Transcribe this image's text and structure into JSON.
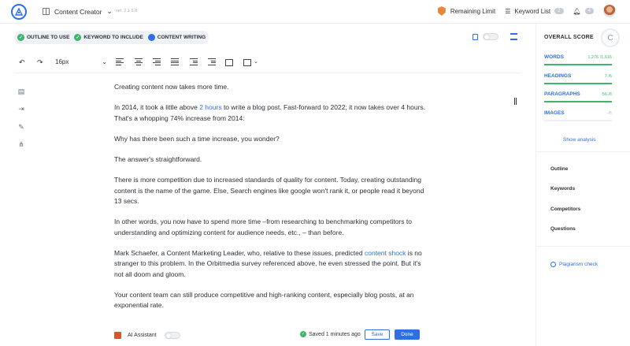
{
  "header": {
    "app_name": "Content Creator",
    "version": "ver. 2.1.5.8",
    "remaining_limit": "Remaining Limit",
    "keyword_list": "Keyword List",
    "keyword_count": "2",
    "notification_count": "4"
  },
  "steps": [
    {
      "label": "OUTLINE TO USE",
      "state": "done"
    },
    {
      "label": "KEYWORD TO INCLUDE",
      "state": "done"
    },
    {
      "label": "CONTENT WRITING",
      "state": "active"
    }
  ],
  "toolbar": {
    "font_size": "16px"
  },
  "editor": {
    "paragraphs": [
      "Creating content now takes more time.",
      {
        "before": "In 2014, it took a little above ",
        "link": "2 hours",
        "after": " to write a blog post. Fast-forward to 2022; it now takes over 4 hours. That's a whopping 74% increase from 2014:"
      },
      "Why has there been such a time increase, you wonder?",
      "The answer's straightforward.",
      "There is more competition due to increased standards of quality for content. Today, creating outstanding content is the name of the game. Else, Search engines like google won't rank it, or people read it beyond 13 secs.",
      "In other words, you now have to spend more time –from researching to benchmarking competitors to understanding and optimizing content for audience needs, etc., – than before.",
      {
        "before": "Mark Schaefer, a Content Marketing Leader, who, relative to these issues, predicted ",
        "link": "content shock",
        "after": " is no stranger to this problem. In the Orbitmedia survey referenced above, he even stressed the point. But it's not all doom and gloom."
      },
      "Your content team can still produce competitive and high-ranking content, especially blog posts, at an exponential rate."
    ]
  },
  "footer": {
    "ai_assistant": "AI Assistant",
    "saved_status": "Saved 1 minutes ago",
    "save_label": "Save",
    "done_label": "Done"
  },
  "score_panel": {
    "title": "OVERALL SCORE",
    "grade": "C",
    "metrics": [
      {
        "label": "WORDS",
        "value": "1,276 /1,616"
      },
      {
        "label": "HEADINGS",
        "value": "7 /6"
      },
      {
        "label": "PARAGRAPHS",
        "value": "56 /6"
      },
      {
        "label": "IMAGES",
        "value": "-/5"
      }
    ],
    "show_analysis": "Show analysis",
    "nav": [
      "Outline",
      "Keywords",
      "Competitors",
      "Questions"
    ],
    "plagiarism": "Plagiarism check"
  },
  "colors": {
    "accent": "#2f6fe4",
    "success": "#3fb56b",
    "warning": "#e8873a"
  }
}
